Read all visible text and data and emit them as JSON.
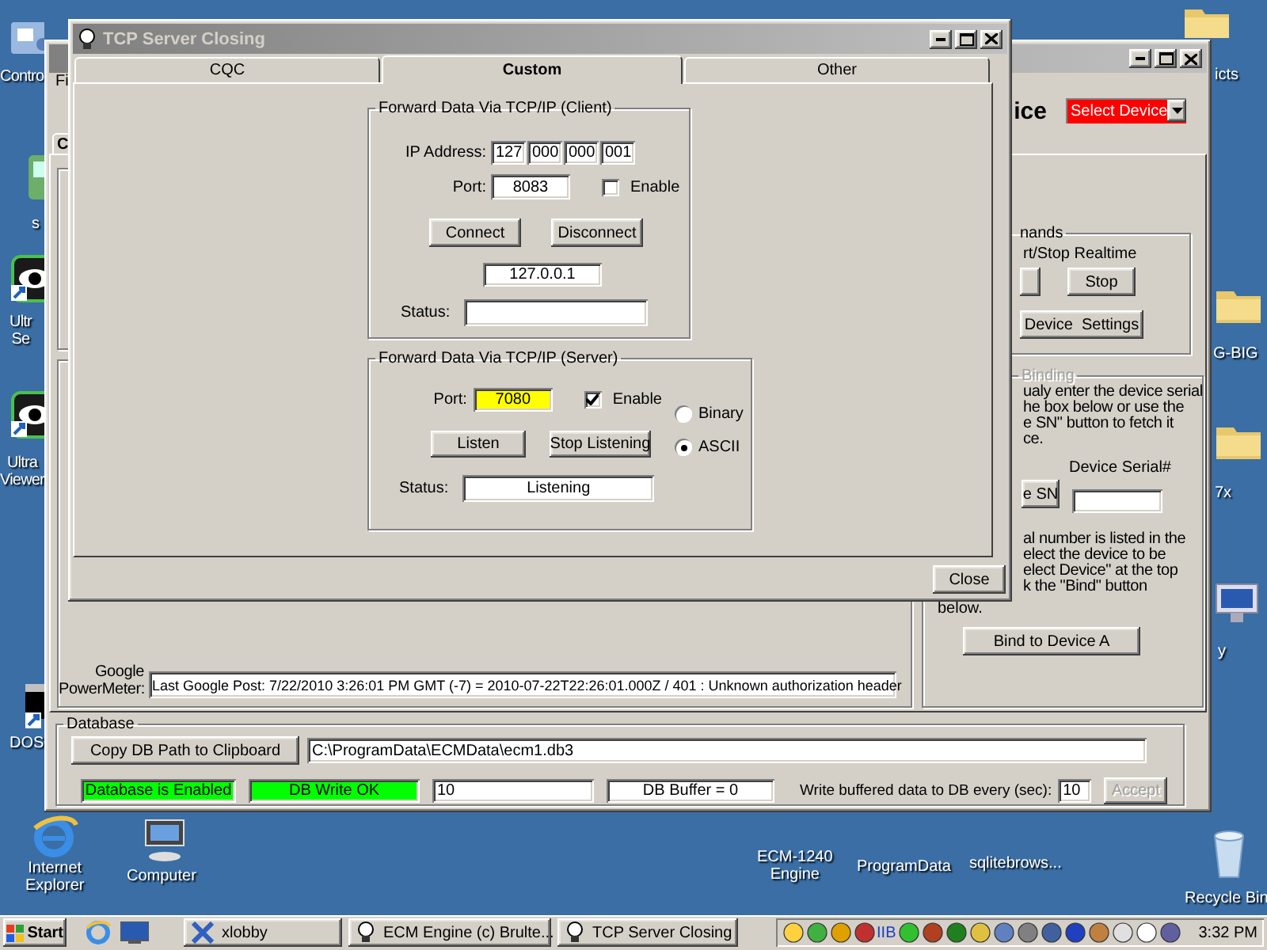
{
  "desktop_icons": [
    {
      "kind": "control-panel",
      "lines": [
        "Contro"
      ]
    },
    {
      "kind": "folder",
      "lines": [
        "icts"
      ]
    },
    {
      "kind": "app",
      "lines": [
        "s"
      ]
    },
    {
      "kind": "eye-app",
      "lines": [
        "Ultr",
        "Se"
      ]
    },
    {
      "kind": "folder",
      "lines": [
        "G-BIG"
      ]
    },
    {
      "kind": "eye-app",
      "lines": [
        "Ultra",
        "Viewer"
      ]
    },
    {
      "kind": "folder",
      "lines": [
        "7x"
      ]
    },
    {
      "kind": "monitor",
      "lines": [
        "y"
      ]
    },
    {
      "kind": "console",
      "lines": [
        "DOS"
      ]
    },
    {
      "kind": "browser",
      "lines": [
        "Internet",
        "Explorer"
      ]
    },
    {
      "kind": "computer",
      "lines": [
        "Computer"
      ]
    },
    {
      "lines": [
        "ECM-1240",
        "Engine"
      ]
    },
    {
      "lines": [
        "ProgramData"
      ]
    },
    {
      "lines": [
        "sqlitebrows..."
      ]
    },
    {
      "kind": "trash",
      "lines": [
        "Recycle Bin"
      ]
    }
  ],
  "back_window": {
    "menu_item": "Fi",
    "device_heading": "ice",
    "device_select": "Select Device",
    "tab": "C",
    "commands": {
      "title": "nands",
      "caption": "rt/Stop Realtime",
      "stop_button": "Stop",
      "settings_button": "Device  Settings"
    },
    "binding": {
      "title": "Binding",
      "disabled": true,
      "instructions": [
        "ualy enter the device serial",
        "he box below or use the",
        "e SN\" button to fetch it",
        "ce."
      ],
      "serial_label": "Device Serial#",
      "fetch_button": "e SN",
      "note": [
        "al number is listed in the",
        "elect the device to be",
        "elect Device\" at the top",
        "k the \"Bind\" button"
      ],
      "note_tail": "below.",
      "bind_button": "Bind to Device A"
    },
    "google": {
      "label": [
        "Google",
        "PowerMeter:"
      ],
      "value": "Last Google Post: 7/22/2010 3:26:01 PM GMT (-7) = 2010-07-22T22:26:01.000Z / 401 : Unknown authorization header"
    },
    "database": {
      "title": "Database",
      "copy_button": "Copy DB Path to Clipboard",
      "path": "C:\\ProgramData\\ECMData\\ecm1.db3",
      "indicators": [
        {
          "label": "Database is Enabled",
          "color": "#00ff00"
        },
        {
          "label": "DB Write OK",
          "color": "#00ff00"
        }
      ],
      "count": "10",
      "buffer": "DB Buffer = 0",
      "interval_label": "Write buffered data to DB every (sec):",
      "interval": "10",
      "accept_button": {
        "label": "Accept",
        "disabled": true
      }
    }
  },
  "dialog": {
    "title": "TCP Server Closing",
    "tabs": [
      {
        "label": "CQC",
        "selected": false
      },
      {
        "label": "Custom",
        "selected": true
      },
      {
        "label": "Other",
        "selected": false
      }
    ],
    "client": {
      "title": "Forward Data Via TCP/IP (Client)",
      "ip_label": "IP Address:",
      "ip": [
        "127",
        "000",
        "000",
        "001"
      ],
      "port_label": "Port:",
      "port": "8083",
      "enable": {
        "label": "Enable",
        "checked": false
      },
      "connect_button": "Connect",
      "disconnect_button": "Disconnect",
      "address": "127.0.0.1",
      "status_label": "Status:"
    },
    "server": {
      "title": "Forward Data Via TCP/IP (Server)",
      "port_label": "Port:",
      "port": "7080",
      "port_highlighted": true,
      "enable": {
        "label": "Enable",
        "checked": true
      },
      "modes": [
        {
          "label": "Binary",
          "selected": false
        },
        {
          "label": "ASCII",
          "selected": true
        }
      ],
      "listen_button": "Listen",
      "stop_button": "Stop Listening",
      "status_label": "Status:",
      "status": "Listening"
    },
    "close_button": "Close"
  },
  "taskbar": {
    "start": "Start",
    "tasks": [
      {
        "label": "xlobby",
        "kind": "x"
      },
      {
        "label": "ECM Engine (c) Brulte...",
        "kind": "bulb"
      },
      {
        "label": "TCP Server Closing",
        "kind": "bulb"
      }
    ],
    "tray_badge": "IIB",
    "clock": "3:32 PM"
  }
}
